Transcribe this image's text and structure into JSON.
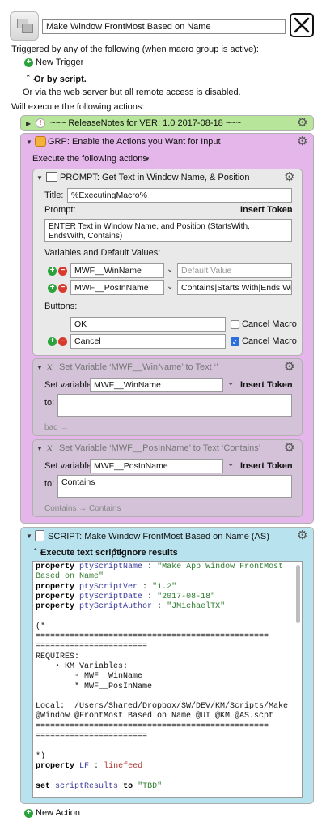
{
  "macro": {
    "name": "Make Window FrontMost Based on Name"
  },
  "triggers": {
    "heading": "Triggered by any of the following (when macro group is active):",
    "new_trigger": "New Trigger",
    "or_by_script": "Or by script.",
    "web_server_note": "Or via the web server but all remote access is disabled.",
    "will_execute": "Will execute the following actions:"
  },
  "release_notes": {
    "title": "~~~ ReleaseNotes for  VER: 1.0    2017-08-18 ~~~",
    "color": "#b7e59a"
  },
  "group": {
    "title": "GRP:  Enable the Actions you Want for Input",
    "execute_label": "Execute the following actions",
    "color": "#e5b6ea"
  },
  "prompt": {
    "title": "PROMPT:  Get Text in Window Name, & Position",
    "title_label": "Title:",
    "title_value": "%ExecutingMacro%",
    "prompt_label": "Prompt:",
    "insert_token": "Insert Token",
    "prompt_text": "ENTER Text in Window Name, and Position (StartsWith, EndsWith, Contains)",
    "variables_label": "Variables and Default Values:",
    "variables": [
      {
        "name": "MWF__WinName",
        "default": "",
        "placeholder": "Default Value"
      },
      {
        "name": "MWF__PosInName",
        "default": "Contains|Starts With|Ends With"
      }
    ],
    "buttons_label": "Buttons:",
    "buttons": [
      {
        "label": "OK",
        "cancel_label": "Cancel Macro",
        "cancel_checked": false
      },
      {
        "label": "Cancel",
        "cancel_label": "Cancel Macro",
        "cancel_checked": true
      }
    ]
  },
  "setvar1": {
    "title": "Set Variable ‘MWF__WinName’ to Text ‘’",
    "set_label": "Set variable",
    "var_name": "MWF__WinName",
    "insert_token": "Insert Token",
    "to_label": "to:",
    "to_value": "",
    "footer": "bad →"
  },
  "setvar2": {
    "title": "Set Variable ‘MWF__PosInName’ to Text ‘Contains’",
    "set_label": "Set variable",
    "var_name": "MWF__PosInName",
    "insert_token": "Insert Token",
    "to_label": "to:",
    "to_value": "Contains",
    "footer": "Contains → Contains"
  },
  "script": {
    "title": "SCRIPT:  Make Window FrontMost Based on Name (AS)",
    "execute_text": "Execute text script",
    "ignore_results": "ignore results",
    "color": "#b8e2ee"
  },
  "new_action": "New Action"
}
